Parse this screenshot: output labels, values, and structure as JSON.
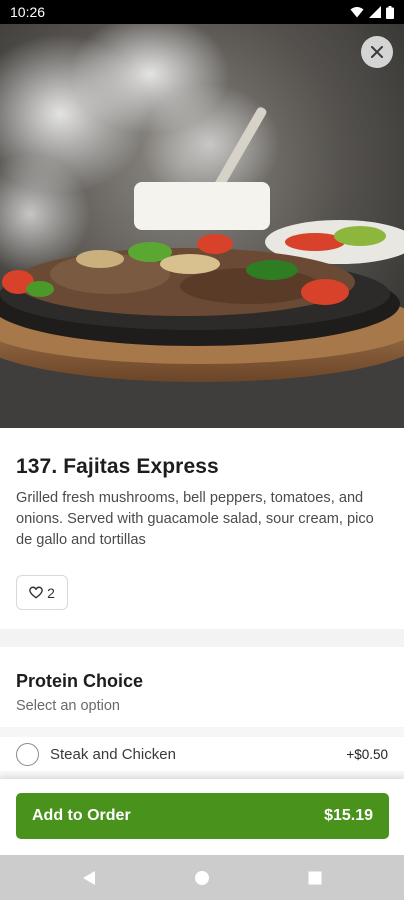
{
  "status_bar": {
    "time": "10:26",
    "icons": [
      "wifi-icon",
      "signal-icon",
      "battery-icon"
    ]
  },
  "hero": {
    "image": "fajitas-on-sizzling-skillet",
    "close_icon": "close-icon"
  },
  "item": {
    "title": "137. Fajitas Express",
    "description": "Grilled fresh mushrooms, bell peppers, tomatoes, and onions. Served with guacamole salad, sour cream, pico de gallo and tortillas",
    "like_count": "2",
    "like_icon": "heart-icon"
  },
  "protein": {
    "title": "Protein Choice",
    "subtitle": "Select an option",
    "options": [
      {
        "label": "Steak and Chicken",
        "price": "+$0.50",
        "selected": false
      }
    ]
  },
  "order": {
    "button_label": "Add to Order",
    "total": "$15.19"
  },
  "navigation": {
    "buttons": [
      "back-icon",
      "home-icon",
      "recents-icon"
    ]
  },
  "colors": {
    "accent": "#49921b",
    "status_bar": "#000000",
    "nav_bar": "#cccccc"
  }
}
